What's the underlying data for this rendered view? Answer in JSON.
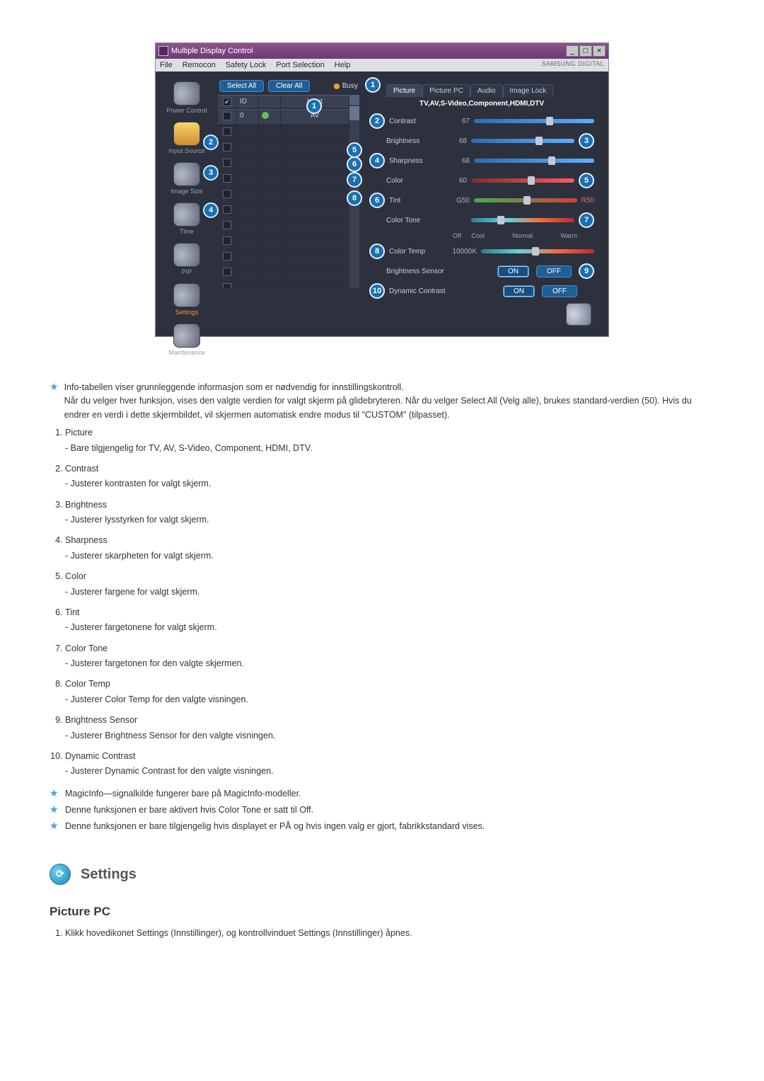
{
  "window": {
    "title": "Multiple Display Control",
    "brand": "SAMSUNG DIGITAL"
  },
  "menu": {
    "file": "File",
    "remocon": "Remocon",
    "safety_lock": "Safety Lock",
    "port_selection": "Port Selection",
    "help": "Help"
  },
  "sidebar": {
    "power_control": "Power Control",
    "input_source": "Input Source",
    "image_size": "Image Size",
    "time": "Time",
    "pip": "PIP",
    "settings": "Settings",
    "maintenance": "Maintenance"
  },
  "top_buttons": {
    "select_all": "Select All",
    "clear_all": "Clear All",
    "busy": "Busy"
  },
  "grid": {
    "headers": {
      "chk": "✔",
      "id": "ID",
      "status": "",
      "input": "Input"
    },
    "row_value": "AV",
    "sample_id": "0"
  },
  "tabs": {
    "picture": "Picture",
    "picture_pc": "Picture PC",
    "audio": "Audio",
    "image_lock": "Image Lock"
  },
  "right": {
    "note": "TV,AV,S-Video,Component,HDMI,DTV",
    "contrast": {
      "label": "Contrast",
      "value": "67"
    },
    "brightness": {
      "label": "Brightness",
      "value": "68"
    },
    "sharpness": {
      "label": "Sharpness",
      "value": "68"
    },
    "color": {
      "label": "Color",
      "value": "60"
    },
    "tint": {
      "label": "Tint",
      "left": "G50",
      "right": "R50"
    },
    "color_tone": {
      "label": "Color Tone",
      "opts": {
        "off": "Off",
        "cool": "Cool",
        "normal": "Normal",
        "warm": "Warm"
      }
    },
    "color_temp": {
      "label": "Color Temp",
      "value": "10000K"
    },
    "bright_sensor": {
      "label": "Brightness Sensor",
      "on": "ON",
      "off": "OFF"
    },
    "dyn_contrast": {
      "label": "Dynamic Contrast",
      "on": "ON",
      "off": "OFF"
    }
  },
  "callouts": {
    "n1": "1",
    "n2": "2",
    "n3": "3",
    "n4": "4",
    "n5": "5",
    "n6": "6",
    "n7": "7",
    "n8": "8",
    "n9": "9",
    "n10": "10"
  },
  "notes": {
    "star1_a": "Info-tabellen viser grunnleggende informasjon som er nødvendig for innstillingskontroll.",
    "star1_b": "Når du velger hver funksjon, vises den valgte verdien for valgt skjerm på glidebryteren. Når du velger Select All (Velg alle), brukes standard-verdien (50). Hvis du endrer en verdi i dette skjermbildet, vil skjermen automatisk endre modus til \"CUSTOM\" (tilpasset).",
    "items": [
      {
        "t": "Picture",
        "d": "- Bare tilgjengelig for TV, AV, S-Video, Component, HDMI, DTV."
      },
      {
        "t": "Contrast",
        "d": "- Justerer kontrasten for valgt skjerm."
      },
      {
        "t": "Brightness",
        "d": "- Justerer lysstyrken for valgt skjerm."
      },
      {
        "t": "Sharpness",
        "d": "- Justerer skarpheten for valgt skjerm."
      },
      {
        "t": "Color",
        "d": "- Justerer fargene for valgt skjerm."
      },
      {
        "t": "Tint",
        "d": "- Justerer fargetonene for valgt skjerm."
      },
      {
        "t": "Color Tone",
        "d": "- Justerer fargetonen for den valgte skjermen."
      },
      {
        "t": "Color Temp",
        "d": "- Justerer Color Temp for den valgte visningen."
      },
      {
        "t": "Brightness Sensor",
        "d": "- Justerer Brightness Sensor for den valgte visningen."
      },
      {
        "t": "Dynamic Contrast",
        "d": "- Justerer Dynamic Contrast for den valgte visningen."
      }
    ],
    "star2": "MagicInfo—signalkilde fungerer bare på MagicInfo-modeller.",
    "star3": "Denne funksjonen er bare aktivert hvis Color Tone er satt til Off.",
    "star4": "Denne funksjonen er bare tilgjengelig hvis displayet er PÅ og hvis ingen valg er gjort, fabrikkstandard vises."
  },
  "section": {
    "title": "Settings",
    "sub": "Picture PC",
    "step1": "Klikk hovedikonet Settings (Innstillinger), og kontrollvinduet Settings (Innstillinger) åpnes."
  }
}
